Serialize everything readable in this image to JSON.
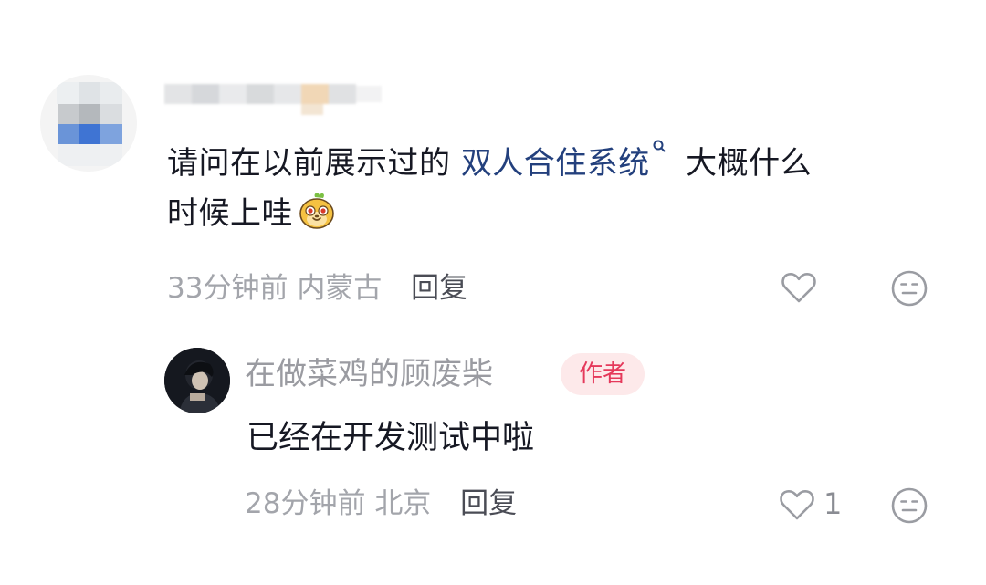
{
  "comment": {
    "text_before": "请问在以前展示过的 ",
    "link_text": "双人合住系统",
    "text_after_line1": " 大概什么",
    "text_line2": "时候上哇",
    "time": "33分钟前",
    "location": "内蒙古",
    "reply_label": "回复",
    "icons": [
      "heart-outline-icon",
      "emoji-reaction-icon",
      "search-icon",
      "emoji-sticker"
    ]
  },
  "reply": {
    "author": "在做菜鸡的顾废柴",
    "badge": "作者",
    "text": "已经在开发测试中啦",
    "time": "28分钟前",
    "location": "北京",
    "reply_label": "回复",
    "like_count": "1",
    "icons": [
      "heart-outline-icon",
      "emoji-reaction-icon"
    ]
  },
  "colors": {
    "text": "#161823",
    "link": "#23407d",
    "meta": "#a3a5ab",
    "author_badge_bg": "#fde9ea",
    "author_badge_text": "#e5395b"
  }
}
